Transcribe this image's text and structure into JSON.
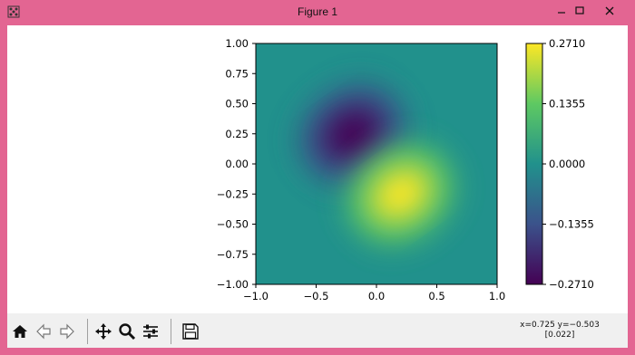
{
  "window": {
    "title": "Figure 1",
    "minimize_icon": "minimize-icon",
    "maximize_icon": "maximize-icon",
    "close_icon": "close-icon"
  },
  "toolbar": {
    "buttons": [
      {
        "name": "home-button",
        "icon": "home-icon"
      },
      {
        "name": "back-button",
        "icon": "arrow-left-icon"
      },
      {
        "name": "forward-button",
        "icon": "arrow-right-icon"
      },
      {
        "name": "pan-button",
        "icon": "move-icon"
      },
      {
        "name": "zoom-button",
        "icon": "zoom-icon"
      },
      {
        "name": "configure-subplots-button",
        "icon": "sliders-icon"
      },
      {
        "name": "save-button",
        "icon": "save-icon"
      }
    ],
    "coords_line1": "x=0.725 y=−0.503",
    "coords_line2": "[0.022]"
  },
  "colors": {
    "titlebar": "#e36592",
    "toolbar": "#f0f0f0",
    "colormap": [
      "#440154",
      "#3b528b",
      "#21918c",
      "#5ec962",
      "#fde725"
    ]
  },
  "chart_data": {
    "type": "heatmap",
    "title": "",
    "xlabel": "",
    "ylabel": "",
    "xlim": [
      -1.0,
      1.0
    ],
    "ylim": [
      -1.0,
      1.0
    ],
    "x_ticks": [
      "−1.0",
      "−0.5",
      "0.0",
      "0.5",
      "1.0"
    ],
    "y_ticks": [
      "1.00",
      "0.75",
      "0.50",
      "0.25",
      "0.00",
      "−0.25",
      "−0.50",
      "−0.75",
      "−1.00"
    ],
    "colorbar_ticks": [
      "0.2710",
      "0.1355",
      "0.0000",
      "−0.1355",
      "−0.2710"
    ],
    "colorbar_range": [
      -0.271,
      0.271
    ],
    "colormap": "viridis",
    "features": [
      {
        "kind": "minimum",
        "x": -0.2,
        "y": 0.25,
        "value": -0.271
      },
      {
        "kind": "maximum",
        "x": 0.2,
        "y": -0.25,
        "value": 0.271
      }
    ]
  }
}
